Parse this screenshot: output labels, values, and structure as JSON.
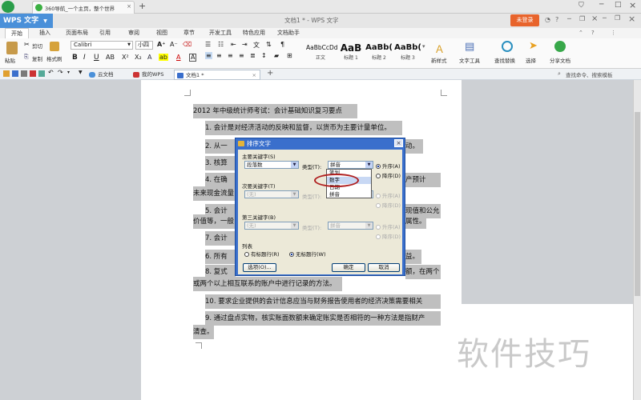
{
  "browser": {
    "tab_label": "360导航_一个主页，整个世界",
    "new_tab": "+"
  },
  "app": {
    "wps_button": "WPS 文字",
    "document_title": "文档1 * - WPS 文字",
    "login_button": "未登录",
    "window_controls": [
      "_",
      "□",
      "×"
    ]
  },
  "ribbon_tabs": [
    "开始",
    "插入",
    "页面布局",
    "引用",
    "审阅",
    "视图",
    "章节",
    "开发工具",
    "特色应用",
    "文档助手"
  ],
  "clipboard": {
    "paste": "粘贴",
    "cut": "剪切",
    "copy": "复制",
    "format_painter": "格式刷"
  },
  "font": {
    "name": "Calibri",
    "size": "小四"
  },
  "styles": [
    {
      "preview": "AaBbCcDd",
      "name": "正文"
    },
    {
      "preview": "AaB",
      "name": "标题 1"
    },
    {
      "preview": "AaBb(",
      "name": "标题 2"
    },
    {
      "preview": "AaBb(",
      "name": "标题 3"
    }
  ],
  "ribbon_right": {
    "new_style": "新样式",
    "text_tools": "文字工具",
    "find_replace": "查找替换",
    "select": "选择",
    "share": "分享文档"
  },
  "quickbar": {
    "tabs": [
      "云文档",
      "我的WPS",
      "文档1 *"
    ],
    "add": "+",
    "search_hint": "查找命令、搜索模板"
  },
  "document": {
    "heading": "2012 年中级统计师考试：会计基础知识复习要点",
    "lines": [
      "1.    会计是对经济活动的反映和监督，以货币为主要计量单位。",
      "2.    从一",
      "3.    核算",
      "4.    在确",
      "未来现金流量",
      "5.    会计",
      "价值等，一般",
      "7.    会计",
      "6.    所有",
      "8.    复式",
      "或两个以上相互联系的账户中进行记录的方法。",
      "10.    要求企业提供的会计信息应当与财务报告使用者的经济决策需要相关",
      "9.    通过盘点实物，核实账面数额来确定账实是否相符的一种方法是指财产",
      "清查。"
    ],
    "line_tails": {
      "line2": "动。",
      "line4": "产预计",
      "line6a": "现值和公允",
      "line6b": "属性。",
      "line8a": "益。",
      "line8b": "额，在两个"
    }
  },
  "dialog": {
    "title": "排序文字",
    "primary_label": "主要关键字(S)",
    "primary_field": "段落数",
    "type_label": "类型(T):",
    "primary_type": "拼音",
    "asc": "升序(A)",
    "desc": "降序(D)",
    "secondary_label": "次要关键字(T)",
    "secondary_field": "(无)",
    "secondary_type": "拼音",
    "tertiary_label": "第三关键字(B)",
    "tertiary_field": "(无)",
    "tertiary_type": "拼音",
    "list_label": "列表",
    "has_header": "有标题行(R)",
    "no_header": "无标题行(W)",
    "options": "选项(O)...",
    "ok": "确定",
    "cancel": "取消",
    "type_options": [
      "笔划",
      "数字",
      "日期",
      "拼音"
    ],
    "type_selected": "数字"
  },
  "watermark": "软件技巧",
  "colors": {
    "accent": "#4a90d9",
    "dialog_title": "#3a6fcc",
    "login": "#e8642c",
    "highlight_oval": "#b02020"
  }
}
